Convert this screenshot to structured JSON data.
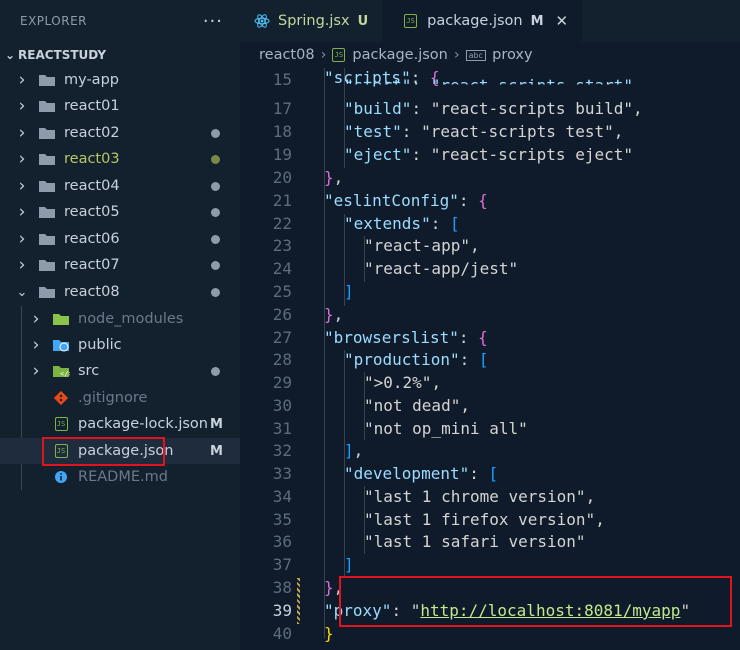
{
  "sidebar": {
    "title": "EXPLORER",
    "more": "···",
    "root": "REACTSTUDY",
    "items": [
      {
        "label": "my-app",
        "dot": ""
      },
      {
        "label": "react01",
        "dot": ""
      },
      {
        "label": "react02",
        "dot": "#8e9bab"
      },
      {
        "label": "react03",
        "dot": "#7a8a46"
      },
      {
        "label": "react04",
        "dot": "#8e9bab"
      },
      {
        "label": "react05",
        "dot": "#8e9bab"
      },
      {
        "label": "react06",
        "dot": "#8e9bab"
      },
      {
        "label": "react07",
        "dot": "#8e9bab"
      },
      {
        "label": "react08",
        "dot": "#8e9bab"
      },
      {
        "label": "node_modules"
      },
      {
        "label": "public"
      },
      {
        "label": "src",
        "dot": "#8e9bab"
      },
      {
        "label": ".gitignore"
      },
      {
        "label": "package-lock.json",
        "mod": "M"
      },
      {
        "label": "package.json",
        "mod": "M"
      },
      {
        "label": "README.md"
      }
    ]
  },
  "tabs": [
    {
      "label": "Spring.jsx",
      "status": "U"
    },
    {
      "label": "package.json",
      "status": "M",
      "close": "✕"
    }
  ],
  "breadcrumb": [
    "react08",
    "package.json",
    "proxy"
  ],
  "editor": {
    "lines": [
      {
        "n": "15"
      },
      {
        "n": "17"
      },
      {
        "n": "18"
      },
      {
        "n": "19"
      },
      {
        "n": "20"
      },
      {
        "n": "21"
      },
      {
        "n": "22"
      },
      {
        "n": "23"
      },
      {
        "n": "24"
      },
      {
        "n": "25"
      },
      {
        "n": "26"
      },
      {
        "n": "27"
      },
      {
        "n": "28"
      },
      {
        "n": "29"
      },
      {
        "n": "30"
      },
      {
        "n": "31"
      },
      {
        "n": "32"
      },
      {
        "n": "33"
      },
      {
        "n": "34"
      },
      {
        "n": "35"
      },
      {
        "n": "36"
      },
      {
        "n": "37"
      },
      {
        "n": "38"
      },
      {
        "n": "39"
      },
      {
        "n": "40"
      }
    ],
    "text": {
      "scripts_key": "\"scripts\"",
      "start_partial": "\"start\": \"react-scripts start\",",
      "build_key": "\"build\"",
      "build_val": "\"react-scripts build\"",
      "test_key": "\"test\"",
      "test_val": "\"react-scripts test\"",
      "eject_key": "\"eject\"",
      "eject_val": "\"react-scripts eject\"",
      "eslint_key": "\"eslintConfig\"",
      "extends_key": "\"extends\"",
      "ext1": "\"react-app\"",
      "ext2": "\"react-app/jest\"",
      "browsers_key": "\"browserslist\"",
      "prod_key": "\"production\"",
      "prod1": "\">0.2%\"",
      "prod2": "\"not dead\"",
      "prod3": "\"not op_mini all\"",
      "dev_key": "\"development\"",
      "dev1": "\"last 1 chrome version\"",
      "dev2": "\"last 1 firefox version\"",
      "dev3": "\"last 1 safari version\"",
      "proxy_key": "\"proxy\"",
      "proxy_url": "http://localhost:8081/myapp"
    }
  },
  "colors": {
    "highlight": "#e0141e",
    "accent": "#1e2c3d"
  }
}
